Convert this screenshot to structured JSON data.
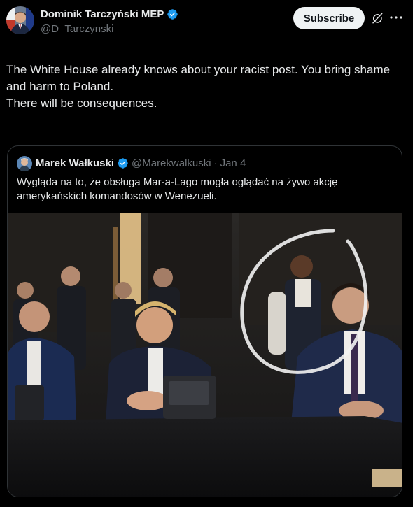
{
  "post": {
    "author": {
      "display_name": "Dominik Tarczyński MEP",
      "handle": "@D_Tarczynski",
      "verified": true
    },
    "subscribe_label": "Subscribe",
    "text": "The White House already knows about your racist post. You bring shame and harm to Poland.\nThere will be consequences."
  },
  "quote": {
    "author": {
      "display_name": "Marek Wałkuski",
      "handle": "@Marekwalkuski",
      "date": "Jan 4",
      "verified": true
    },
    "separator": "·",
    "text": "Wygląda na to, że obsługa Mar-a-Lago mogła oglądać na żywo akcję amerykańskich komandosów w Wenezueli."
  },
  "icons": {
    "verified": "verified-badge-icon",
    "grok": "grok-icon",
    "more": "more-icon"
  },
  "colors": {
    "background": "#000000",
    "text": "#e7e9ea",
    "muted": "#71767b",
    "verified": "#1d9bf0",
    "border": "#2f3336",
    "button_bg": "#eff3f4"
  }
}
